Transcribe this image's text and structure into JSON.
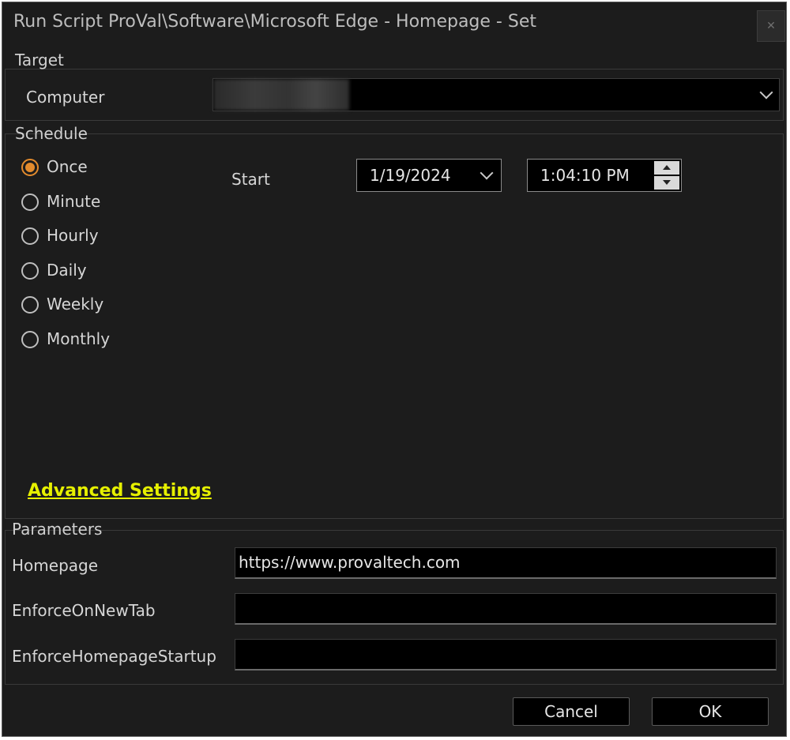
{
  "window": {
    "title": "Run Script ProVal\\Software\\Microsoft Edge - Homepage - Set",
    "close_symbol": "✕"
  },
  "target": {
    "group_label": "Target",
    "computer_label": "Computer",
    "computer_value": ""
  },
  "schedule": {
    "group_label": "Schedule",
    "options": [
      "Once",
      "Minute",
      "Hourly",
      "Daily",
      "Weekly",
      "Monthly"
    ],
    "selected": "Once",
    "start_label": "Start",
    "start_date": "1/19/2024",
    "start_time": "1:04:10 PM",
    "advanced_link": "Advanced Settings"
  },
  "parameters": {
    "group_label": "Parameters",
    "fields": [
      {
        "label": "Homepage",
        "value": "https://www.provaltech.com"
      },
      {
        "label": "EnforceOnNewTab",
        "value": ""
      },
      {
        "label": "EnforceHomepageStartup",
        "value": ""
      }
    ]
  },
  "buttons": {
    "cancel": "Cancel",
    "ok": "OK"
  },
  "colors": {
    "background": "#1c1c1c",
    "radio_accent": "#e38b2d",
    "link": "#e6f000"
  }
}
